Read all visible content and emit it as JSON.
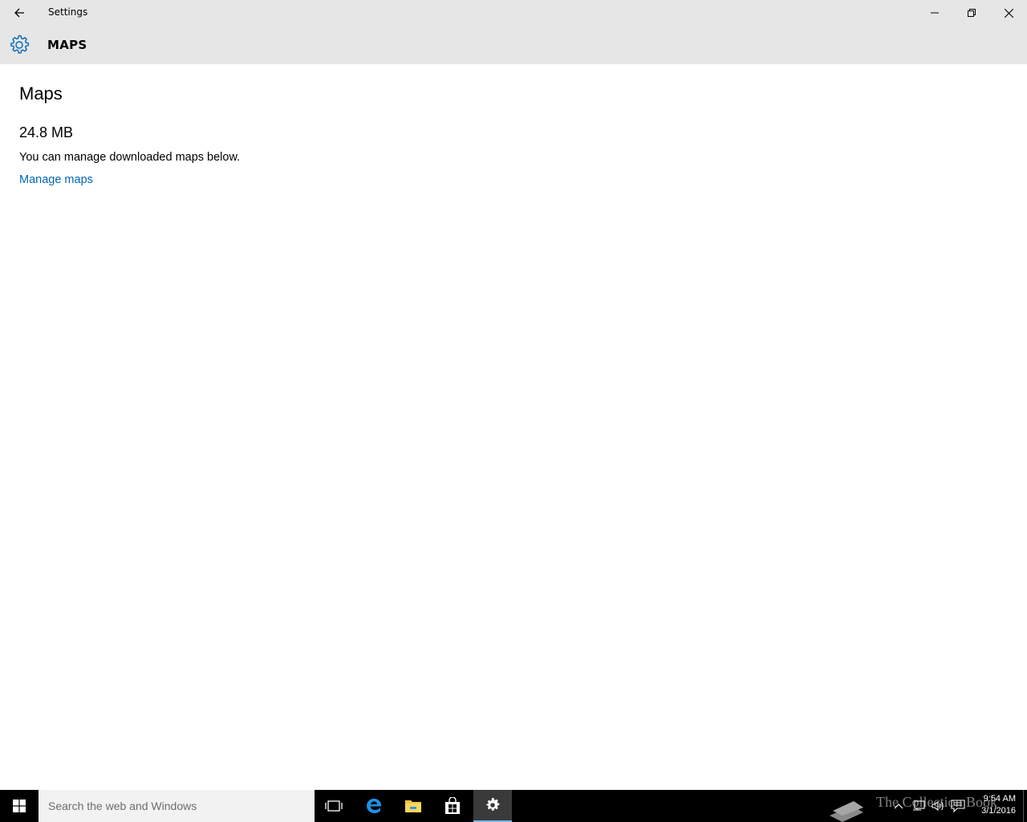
{
  "window": {
    "title": "Settings"
  },
  "header": {
    "title": "MAPS"
  },
  "main": {
    "heading": "Maps",
    "storage_size": "24.8 MB",
    "description": "You can manage downloaded maps below.",
    "manage_link": "Manage maps"
  },
  "taskbar": {
    "search_placeholder": "Search the web and Windows",
    "watermark": "The Collection Book",
    "time": "9:54 AM",
    "date": "3/1/2016"
  },
  "colors": {
    "accent": "#0067b8",
    "chrome": "#e6e6e6",
    "taskbar": "#000000"
  },
  "icons": [
    "back-arrow-icon",
    "minimize-icon",
    "maximize-icon",
    "close-icon",
    "gear-icon",
    "windows-logo-icon",
    "task-view-icon",
    "edge-icon",
    "file-explorer-icon",
    "store-icon",
    "settings-gear-icon",
    "chevron-up-icon",
    "network-icon",
    "volume-icon",
    "action-center-icon"
  ]
}
